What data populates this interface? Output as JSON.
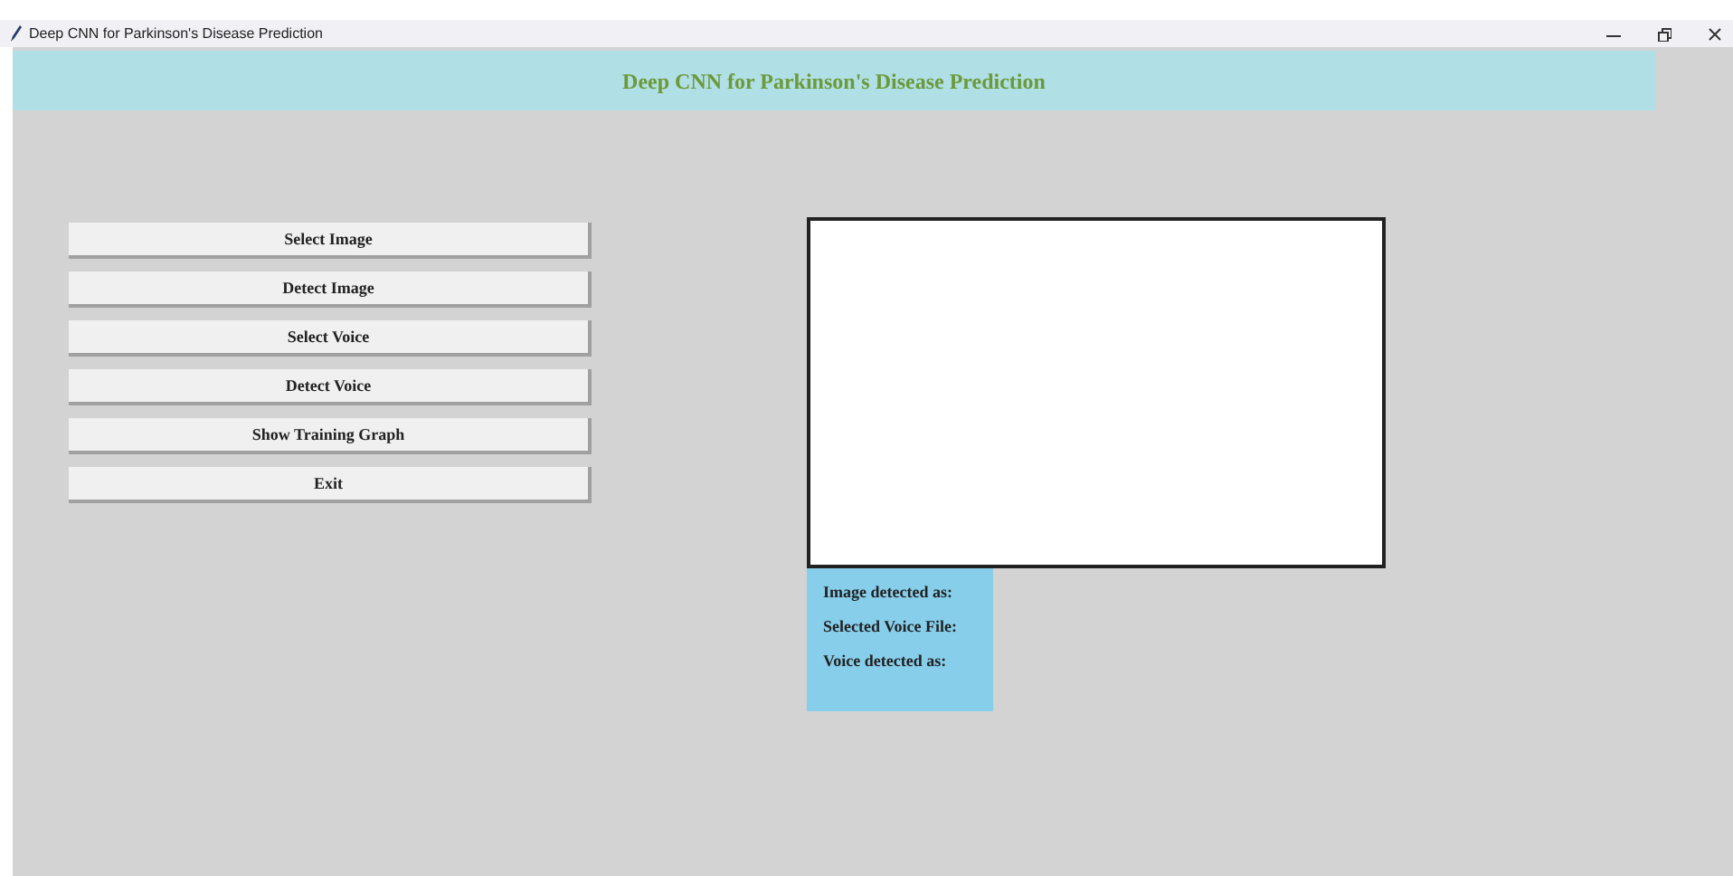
{
  "window": {
    "title": "Deep CNN for Parkinson's Disease Prediction"
  },
  "header": {
    "title": "Deep CNN for Parkinson's Disease Prediction"
  },
  "buttons": [
    "Select Image",
    "Detect Image",
    "Select Voice",
    "Detect Voice",
    "Show Training Graph",
    "Exit"
  ],
  "results": [
    "Image detected as:",
    "Selected Voice File:",
    "Voice detected as:"
  ]
}
